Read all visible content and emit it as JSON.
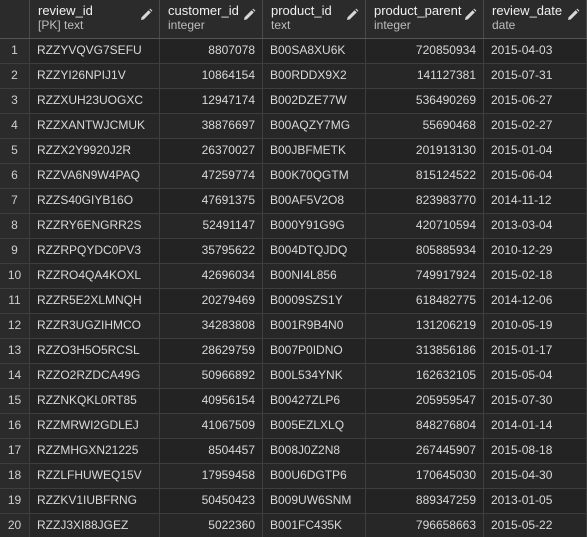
{
  "columns": [
    {
      "name": "review_id",
      "type": "[PK] text"
    },
    {
      "name": "customer_id",
      "type": "integer"
    },
    {
      "name": "product_id",
      "type": "text"
    },
    {
      "name": "product_parent",
      "type": "integer"
    },
    {
      "name": "review_date",
      "type": "date"
    }
  ],
  "rows": [
    {
      "n": "1",
      "review_id": "RZZYVQVG7SEFU",
      "customer_id": "8807078",
      "product_id": "B00SA8XU6K",
      "product_parent": "720850934",
      "review_date": "2015-04-03"
    },
    {
      "n": "2",
      "review_id": "RZZYI26NPIJ1V",
      "customer_id": "10864154",
      "product_id": "B00RDDX9X2",
      "product_parent": "141127381",
      "review_date": "2015-07-31"
    },
    {
      "n": "3",
      "review_id": "RZZXUH23UOGXC",
      "customer_id": "12947174",
      "product_id": "B002DZE77W",
      "product_parent": "536490269",
      "review_date": "2015-06-27"
    },
    {
      "n": "4",
      "review_id": "RZZXANTWJCMUK",
      "customer_id": "38876697",
      "product_id": "B00AQZY7MG",
      "product_parent": "55690468",
      "review_date": "2015-02-27"
    },
    {
      "n": "5",
      "review_id": "RZZX2Y9920J2R",
      "customer_id": "26370027",
      "product_id": "B00JBFMETK",
      "product_parent": "201913130",
      "review_date": "2015-01-04"
    },
    {
      "n": "6",
      "review_id": "RZZVA6N9W4PAQ",
      "customer_id": "47259774",
      "product_id": "B00K70QGTM",
      "product_parent": "815124522",
      "review_date": "2015-06-04"
    },
    {
      "n": "7",
      "review_id": "RZZS40GIYB16O",
      "customer_id": "47691375",
      "product_id": "B00AF5V2O8",
      "product_parent": "823983770",
      "review_date": "2014-11-12"
    },
    {
      "n": "8",
      "review_id": "RZZRY6ENGRR2S",
      "customer_id": "52491147",
      "product_id": "B000Y91G9G",
      "product_parent": "420710594",
      "review_date": "2013-03-04"
    },
    {
      "n": "9",
      "review_id": "RZZRPQYDC0PV3",
      "customer_id": "35795622",
      "product_id": "B004DTQJDQ",
      "product_parent": "805885934",
      "review_date": "2010-12-29"
    },
    {
      "n": "10",
      "review_id": "RZZRO4QA4KOXL",
      "customer_id": "42696034",
      "product_id": "B00NI4L856",
      "product_parent": "749917924",
      "review_date": "2015-02-18"
    },
    {
      "n": "11",
      "review_id": "RZZR5E2XLMNQH",
      "customer_id": "20279469",
      "product_id": "B0009SZS1Y",
      "product_parent": "618482775",
      "review_date": "2014-12-06"
    },
    {
      "n": "12",
      "review_id": "RZZR3UGZIHMCO",
      "customer_id": "34283808",
      "product_id": "B001R9B4N0",
      "product_parent": "131206219",
      "review_date": "2010-05-19"
    },
    {
      "n": "13",
      "review_id": "RZZO3H5O5RCSL",
      "customer_id": "28629759",
      "product_id": "B007P0IDNO",
      "product_parent": "313856186",
      "review_date": "2015-01-17"
    },
    {
      "n": "14",
      "review_id": "RZZO2RZDCA49G",
      "customer_id": "50966892",
      "product_id": "B00L534YNK",
      "product_parent": "162632105",
      "review_date": "2015-05-04"
    },
    {
      "n": "15",
      "review_id": "RZZNKQKL0RT85",
      "customer_id": "40956154",
      "product_id": "B00427ZLP6",
      "product_parent": "205959547",
      "review_date": "2015-07-30"
    },
    {
      "n": "16",
      "review_id": "RZZMRWI2GDLEJ",
      "customer_id": "41067509",
      "product_id": "B005EZLXLQ",
      "product_parent": "848276804",
      "review_date": "2014-01-14"
    },
    {
      "n": "17",
      "review_id": "RZZMHGXN21225",
      "customer_id": "8504457",
      "product_id": "B008J0Z2N8",
      "product_parent": "267445907",
      "review_date": "2015-08-18"
    },
    {
      "n": "18",
      "review_id": "RZZLFHUWEQ15V",
      "customer_id": "17959458",
      "product_id": "B00U6DGTP6",
      "product_parent": "170645030",
      "review_date": "2015-04-30"
    },
    {
      "n": "19",
      "review_id": "RZZKV1IUBFRNG",
      "customer_id": "50450423",
      "product_id": "B009UW6SNM",
      "product_parent": "889347259",
      "review_date": "2013-01-05"
    },
    {
      "n": "20",
      "review_id": "RZZJ3XI88JGEZ",
      "customer_id": "5022360",
      "product_id": "B001FC435K",
      "product_parent": "796658663",
      "review_date": "2015-05-22"
    }
  ]
}
